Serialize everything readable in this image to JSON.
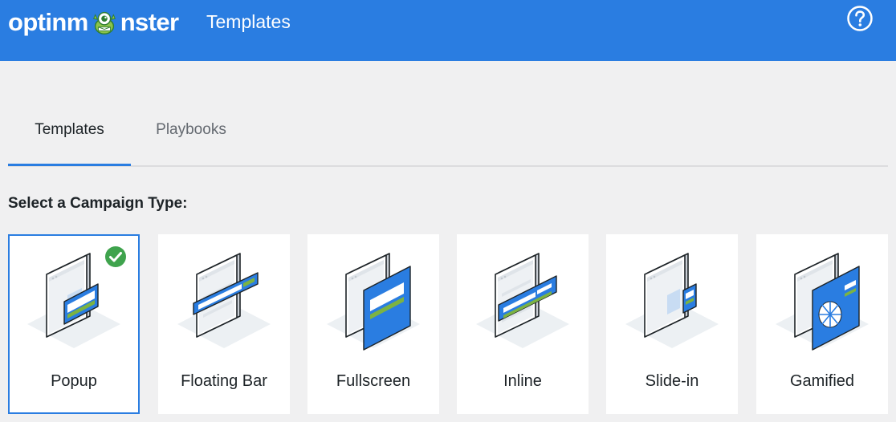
{
  "header": {
    "logo_text_before": "optinm",
    "logo_text_after": "nster",
    "page_title": "Templates",
    "help_icon": "help-circle-icon"
  },
  "tabs": [
    {
      "label": "Templates",
      "active": true
    },
    {
      "label": "Playbooks",
      "active": false
    }
  ],
  "section_title": "Select a Campaign Type:",
  "campaign_types": [
    {
      "label": "Popup",
      "selected": true
    },
    {
      "label": "Floating Bar",
      "selected": false
    },
    {
      "label": "Fullscreen",
      "selected": false
    },
    {
      "label": "Inline",
      "selected": false
    },
    {
      "label": "Slide-in",
      "selected": false
    },
    {
      "label": "Gamified",
      "selected": false
    }
  ],
  "colors": {
    "brand_blue": "#2a7de1",
    "accent_green": "#7cb342",
    "check_green": "#3fa34d",
    "background": "#f0f0f1"
  }
}
